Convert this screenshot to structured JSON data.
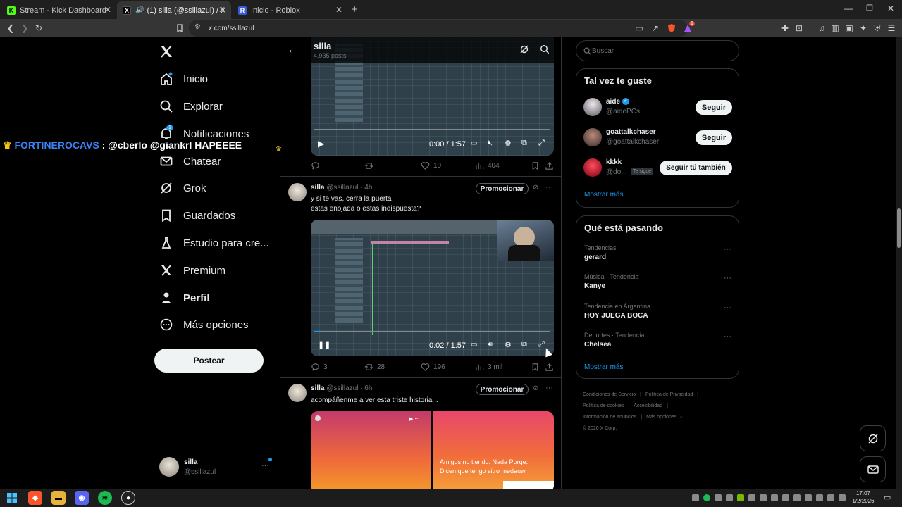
{
  "browser": {
    "tabs": [
      {
        "title": "Stream - Kick Dashboard",
        "favicon": "K"
      },
      {
        "title": "(1) silla (@ssillazul) / X",
        "favicon": "X"
      },
      {
        "title": "Inicio - Roblox",
        "favicon": "R"
      }
    ],
    "new_tab": "+",
    "url": "x.com/ssillazul",
    "brave_badge": "1"
  },
  "overlay": {
    "name": "FORTINEROCAVS",
    "sep": " : ",
    "message": "@cberlo @giankrl HAPEEEE"
  },
  "nav": {
    "items": [
      {
        "label": "Inicio",
        "icon": "home-icon"
      },
      {
        "label": "Explorar",
        "icon": "search-icon"
      },
      {
        "label": "Notificaciones",
        "icon": "bell-icon",
        "badge": "1"
      },
      {
        "label": "Chatear",
        "icon": "mail-icon"
      },
      {
        "label": "Grok",
        "icon": "grok-icon"
      },
      {
        "label": "Guardados",
        "icon": "bookmark-icon"
      },
      {
        "label": "Estudio para cre...",
        "icon": "flask-icon"
      },
      {
        "label": "Premium",
        "icon": "x-icon"
      },
      {
        "label": "Perfil",
        "icon": "person-icon"
      },
      {
        "label": "Más opciones",
        "icon": "more-circle-icon"
      }
    ],
    "post_button": "Postear",
    "account": {
      "name": "silla",
      "handle": "@ssillazul"
    }
  },
  "header": {
    "name": "silla",
    "posts": "4.935 posts"
  },
  "posts": [
    {
      "video": {
        "time": "0:00 / 1:57"
      },
      "stats": {
        "replies": "",
        "reposts": "",
        "likes": "10",
        "views": "404"
      }
    },
    {
      "name": "silla",
      "handle": "@ssillazul",
      "age": "· 4h",
      "promote": "Promocionar",
      "text1": "y si te vas, cerra la puerta",
      "text2": "estas enojada o estas indispuesta?",
      "video": {
        "time": "0:02 / 1:57"
      },
      "stats": {
        "replies": "3",
        "reposts": "28",
        "likes": "196",
        "views": "3 mil"
      }
    },
    {
      "name": "silla",
      "handle": "@ssillazul",
      "age": "· 6h",
      "promote": "Promocionar",
      "text1": "acompáñenme a ver esta triste historia...",
      "image_caption": "Amigos no tiendo. Nada Porqe. Dicen que tengo sitro medauw."
    }
  ],
  "search": {
    "placeholder": "Buscar"
  },
  "suggestions": {
    "title": "Tal vez te guste",
    "users": [
      {
        "name": "aide",
        "handle": "@aidePCs",
        "verified": true,
        "button": "Seguir"
      },
      {
        "name": "goattalkchaser",
        "handle": "@goattalkchaser",
        "button": "Seguir"
      },
      {
        "name": "kkkk",
        "handle": "@do...",
        "follows_you": "Te sigue",
        "button": "Seguir tú también"
      }
    ],
    "more": "Mostrar más"
  },
  "trends": {
    "title": "Qué está pasando",
    "items": [
      {
        "context": "Tendencias",
        "name": "gerard"
      },
      {
        "context": "Música · Tendencia",
        "name": "Kanye"
      },
      {
        "context": "Tendencia en Argentina",
        "name": "HOY JUEGA BOCA"
      },
      {
        "context": "Deportes · Tendencia",
        "name": "Chelsea"
      }
    ],
    "more": "Mostrar más"
  },
  "footer": {
    "links": [
      "Condiciones de Servicio",
      "Política de Privacidad",
      "Política de cookies",
      "Accesibilidad",
      "Información de anuncios",
      "Más opciones ···"
    ],
    "copyright": "© 2026 X Corp."
  },
  "taskbar": {
    "time": "17:07",
    "date": "1/2/2026"
  },
  "colors": {
    "accent": "#1d9bf0",
    "kick": "#53fc18",
    "overlay_name": "#3b82f6"
  }
}
